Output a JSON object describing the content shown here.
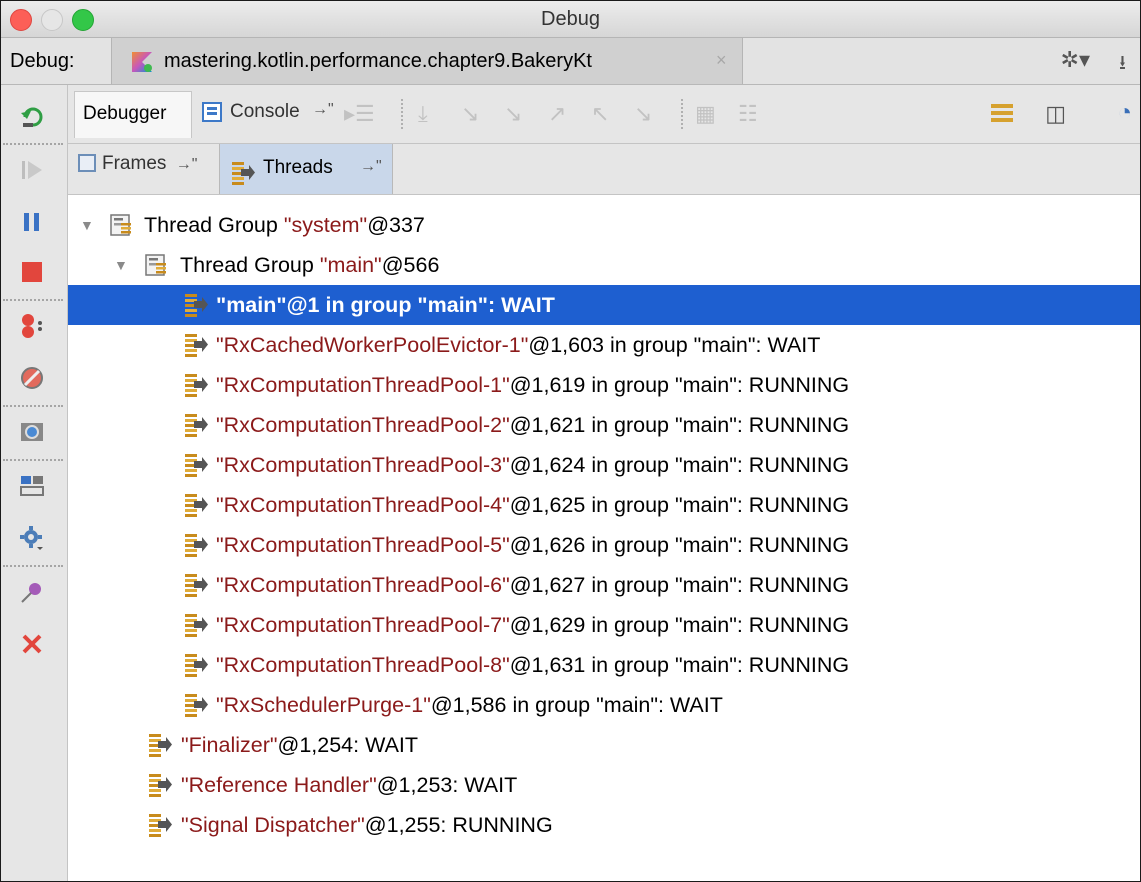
{
  "window": {
    "title": "Debug"
  },
  "tabrow": {
    "label": "Debug:",
    "run_tab": "mastering.kotlin.performance.chapter9.BakeryKt",
    "close_glyph": "×",
    "settings_glyph": "✲▾",
    "pin_glyph": "⭳"
  },
  "debugger_tabs": {
    "debugger": "Debugger",
    "console": "Console",
    "pin_glyph": "→\""
  },
  "sub_tabs": {
    "frames": "Frames",
    "threads": "Threads",
    "pin_glyph": "→\""
  },
  "icons": {
    "rerun": "rerun-icon",
    "resume": "resume-icon",
    "pause": "pause-icon",
    "stop": "stop-icon",
    "breakpoints": "view-breakpoints-icon",
    "mute": "mute-breakpoints-icon",
    "snapshot": "camera-icon",
    "layout": "layout-icon",
    "settings": "gear-icon",
    "pin": "pin-icon",
    "close": "close-icon"
  },
  "colors": {
    "selection": "#1e5fd0",
    "thread_name": "#8b1a1a"
  },
  "threads": {
    "group_system": {
      "prefix": "Thread Group ",
      "name": "\"system\"",
      "suffix": "@337"
    },
    "group_main": {
      "prefix": "Thread Group ",
      "name": "\"main\"",
      "suffix": "@566"
    },
    "main_threads": [
      {
        "name": "\"main\"",
        "suffix": "@1 in group \"main\": WAIT",
        "selected": true
      },
      {
        "name": "\"RxCachedWorkerPoolEvictor-1\"",
        "suffix": "@1,603 in group \"main\": WAIT"
      },
      {
        "name": "\"RxComputationThreadPool-1\"",
        "suffix": "@1,619 in group \"main\": RUNNING"
      },
      {
        "name": "\"RxComputationThreadPool-2\"",
        "suffix": "@1,621 in group \"main\": RUNNING"
      },
      {
        "name": "\"RxComputationThreadPool-3\"",
        "suffix": "@1,624 in group \"main\": RUNNING"
      },
      {
        "name": "\"RxComputationThreadPool-4\"",
        "suffix": "@1,625 in group \"main\": RUNNING"
      },
      {
        "name": "\"RxComputationThreadPool-5\"",
        "suffix": "@1,626 in group \"main\": RUNNING"
      },
      {
        "name": "\"RxComputationThreadPool-6\"",
        "suffix": "@1,627 in group \"main\": RUNNING"
      },
      {
        "name": "\"RxComputationThreadPool-7\"",
        "suffix": "@1,629 in group \"main\": RUNNING"
      },
      {
        "name": "\"RxComputationThreadPool-8\"",
        "suffix": "@1,631 in group \"main\": RUNNING"
      },
      {
        "name": "\"RxSchedulerPurge-1\"",
        "suffix": "@1,586 in group \"main\": WAIT"
      }
    ],
    "system_threads": [
      {
        "name": "\"Finalizer\"",
        "suffix": "@1,254: WAIT"
      },
      {
        "name": "\"Reference Handler\"",
        "suffix": "@1,253: WAIT"
      },
      {
        "name": "\"Signal Dispatcher\"",
        "suffix": "@1,255: RUNNING"
      }
    ]
  }
}
